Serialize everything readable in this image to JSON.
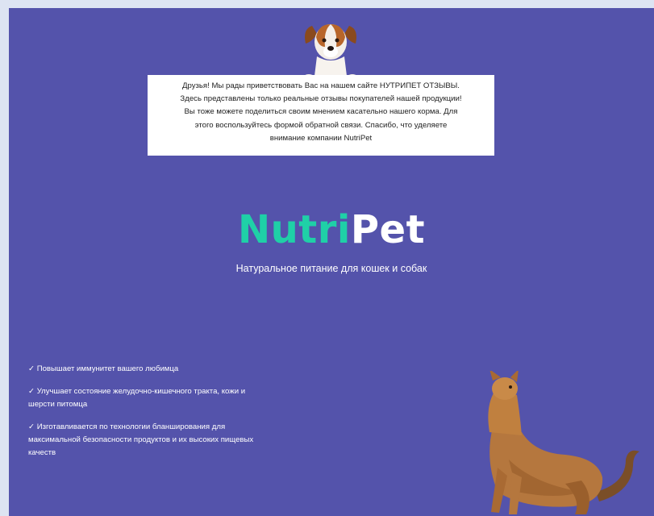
{
  "welcome": {
    "lines": [
      "Друзья! Мы рады приветствовать Вас на нашем сайте НУТРИПЕТ ОТЗЫВЫ.",
      "Здесь представлены только реальные отзывы покупателей нашей продукции!",
      "Вы тоже можете поделиться своим мнением касательно нашего корма. Для",
      "этого воспользуйтесь формой обратной связи. Спасибо, что уделяете",
      "внимание компании NutriPet"
    ]
  },
  "logo": {
    "part1": "Nutri",
    "part2": "Pet"
  },
  "tagline": "Натуральное питание для кошек и собак",
  "benefits": [
    "✓ Повышает иммунитет вашего любимца",
    "✓ Улучшает состояние желудочно-кишечного тракта, кожи и шерсти питомца",
    "✓ Изготавливается по технологии бланширования для максимальной безопасности продуктов и их высоких пищевых качеств"
  ],
  "colors": {
    "background": "#5453ab",
    "logo_accent": "#1fd0a7",
    "text": "#ffffff"
  },
  "icons": {
    "dog": "dog-image",
    "cat": "cat-image"
  }
}
